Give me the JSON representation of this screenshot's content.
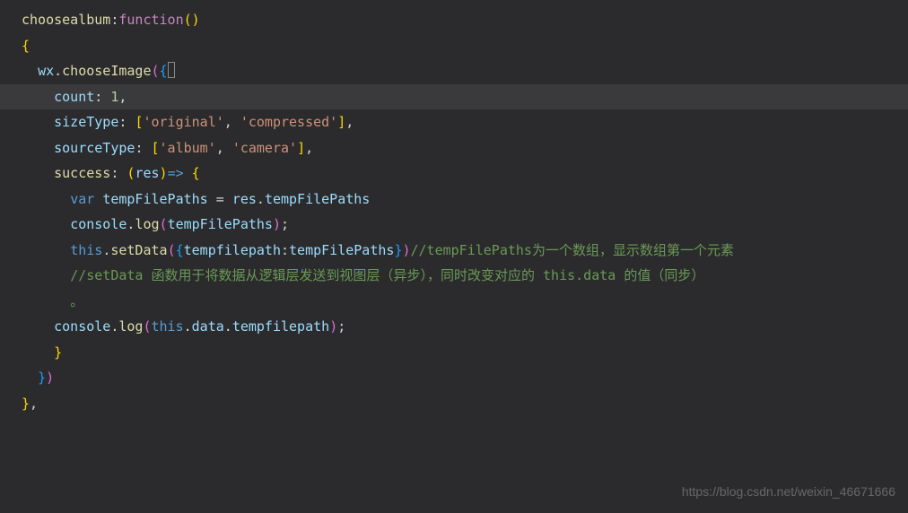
{
  "code": {
    "l1_fn": "choosealbum",
    "l1_key": "function",
    "l3_obj": "wx",
    "l3_method": "chooseImage",
    "l4_prop": "count",
    "l4_val": "1",
    "l5_prop": "sizeType",
    "l5_s1": "'original'",
    "l5_s2": "'compressed'",
    "l6_prop": "sourceType",
    "l6_s1": "'album'",
    "l6_s2": "'camera'",
    "l7_prop": "success",
    "l7_param": "res",
    "l8_kw": "var",
    "l8_var": "tempFilePaths",
    "l8_rhs_obj": "res",
    "l8_rhs_prop": "tempFilePaths",
    "l9_obj": "console",
    "l9_method": "log",
    "l9_arg": "tempFilePaths",
    "l10_this": "this",
    "l10_method": "setData",
    "l10_key": "tempfilepath",
    "l10_val": "tempFilePaths",
    "l10_comm": "//tempFilePaths为一个数组，显示数组第一个元素",
    "l11_comm": "//setData 函数用于将数据从逻辑层发送到视图层（异步），同时改变对应的 this.data 的值（同步）",
    "l12_comm": "。",
    "l13_obj": "console",
    "l13_method": "log",
    "l13_this": "this",
    "l13_p1": "data",
    "l13_p2": "tempfilepath"
  },
  "watermark": "https://blog.csdn.net/weixin_46671666"
}
